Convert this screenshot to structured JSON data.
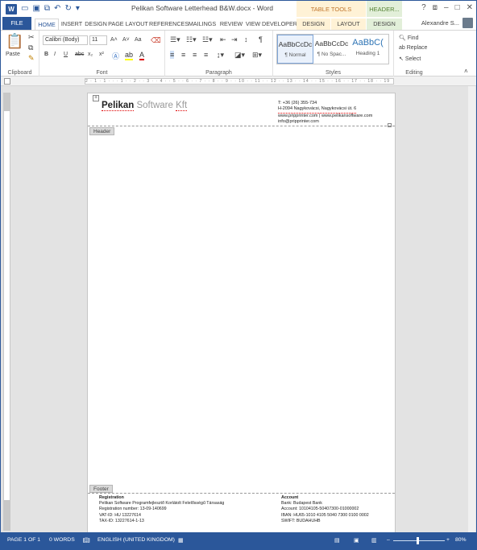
{
  "titlebar": {
    "title": "Pelikan Software Letterhead B&W.docx - Word",
    "ctx_table": "TABLE TOOLS",
    "ctx_header": "HEADER...",
    "help": "?"
  },
  "tabs": [
    "FILE",
    "HOME",
    "INSERT",
    "DESIGN",
    "PAGE LAYOUT",
    "REFERENCES",
    "MAILINGS",
    "REVIEW",
    "VIEW",
    "DEVELOPER",
    "DESIGN",
    "LAYOUT",
    "DESIGN"
  ],
  "user": {
    "name": "Alexandre S..."
  },
  "ribbon": {
    "clipboard": {
      "paste": "Paste",
      "label": "Clipboard"
    },
    "font": {
      "name": "Calibri (Body)",
      "size": "11",
      "bold": "B",
      "italic": "I",
      "underline": "U",
      "strike": "abc",
      "sub": "x₂",
      "sup": "x²",
      "grow": "A˄",
      "shrink": "A˅",
      "case": "Aa",
      "label": "Font"
    },
    "paragraph": {
      "label": "Paragraph"
    },
    "styles": {
      "items": [
        {
          "sample": "AaBbCcDc",
          "name": "¶ Normal"
        },
        {
          "sample": "AaBbCcDc",
          "name": "¶ No Spac..."
        },
        {
          "sample": "AaBbC(",
          "name": "Heading 1"
        }
      ],
      "label": "Styles"
    },
    "editing": {
      "find": "Find",
      "replace": "Replace",
      "select": "Select",
      "label": "Editing"
    }
  },
  "ruler": {
    "marks": "2 · 1 · 1 · · · 1 · · 2 · · 3 · · 4 · · 5 · · 6 · · 7 · · 8 · · 9 · · 10 · · 11 · · 12 · · 13 · · 14 · · 15 · · 16 · · 17 · · 18 · · 19"
  },
  "document": {
    "logo_brand": "Pelikan",
    "logo_rest": "Software",
    "logo_kft": "Kft",
    "contact": [
      "T: +36 (26) 355-734",
      "H-2094 Nagykovácsi, Nagykovácsi út. 6",
      "www.pripprinter.com | www.pelikansoftware.com",
      "info@pripprinter.com"
    ],
    "header_tag": "Header",
    "footer_tag": "Footer",
    "registration": {
      "title": "Registration",
      "lines": [
        "Pelikan Software Programfejlesztő Korlátolt Felelősségű Társaság",
        "Registration number: 13-09-140699",
        "VAT-ID:    HU 13227614",
        "TAX-ID:    13227614-1-13"
      ]
    },
    "account": {
      "title": "Account",
      "lines": [
        "Bank: Budapest Bank",
        "Account: 10104105-50407300-01000002",
        "IBAN: HU65-1010 4105 5040 7300 0100 0002",
        "SWIFT: BUDAHUHB"
      ]
    }
  },
  "status": {
    "page": "PAGE 1 OF 1",
    "words": "0 WORDS",
    "language": "ENGLISH (UNITED KINGDOM)",
    "zoom": "80%"
  }
}
